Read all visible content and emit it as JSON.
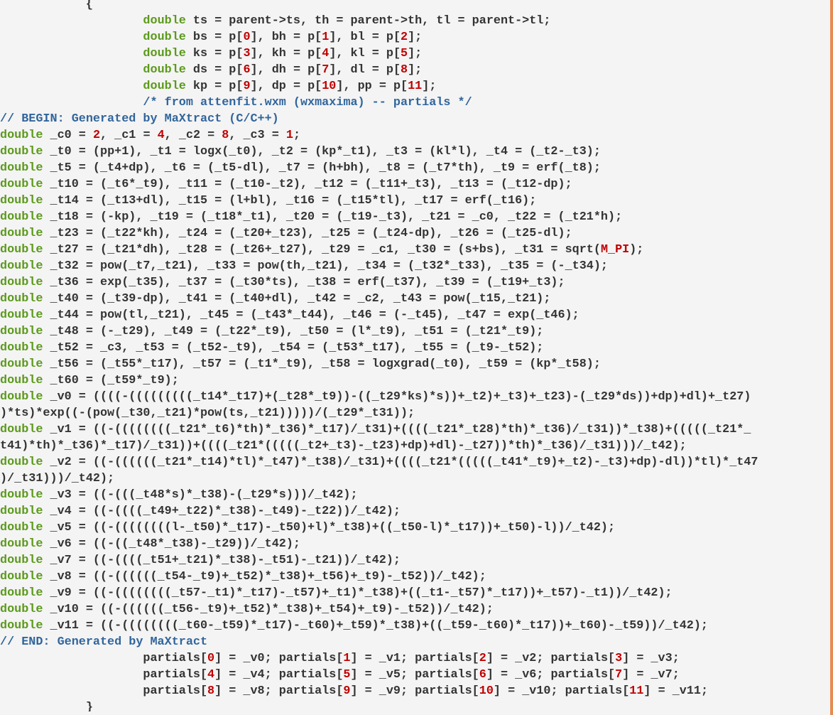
{
  "colors": {
    "background": "#f4f4f4",
    "keyword": "#5c9a1c",
    "number": "#c00000",
    "comment": "#31659c",
    "text": "#333333",
    "edge_bar": "#e58b52"
  },
  "lines": [
    [
      [
        "p",
        "            {"
      ]
    ],
    [
      [
        "p",
        "                    "
      ],
      [
        "k",
        "double"
      ],
      [
        "p",
        " ts = parent->ts, th = parent->th, tl = parent->tl;"
      ]
    ],
    [
      [
        "p",
        "                    "
      ],
      [
        "k",
        "double"
      ],
      [
        "p",
        " bs = p["
      ],
      [
        "n",
        "0"
      ],
      [
        "p",
        "], bh = p["
      ],
      [
        "n",
        "1"
      ],
      [
        "p",
        "], bl = p["
      ],
      [
        "n",
        "2"
      ],
      [
        "p",
        "];"
      ]
    ],
    [
      [
        "p",
        "                    "
      ],
      [
        "k",
        "double"
      ],
      [
        "p",
        " ks = p["
      ],
      [
        "n",
        "3"
      ],
      [
        "p",
        "], kh = p["
      ],
      [
        "n",
        "4"
      ],
      [
        "p",
        "], kl = p["
      ],
      [
        "n",
        "5"
      ],
      [
        "p",
        "];"
      ]
    ],
    [
      [
        "p",
        "                    "
      ],
      [
        "k",
        "double"
      ],
      [
        "p",
        " ds = p["
      ],
      [
        "n",
        "6"
      ],
      [
        "p",
        "], dh = p["
      ],
      [
        "n",
        "7"
      ],
      [
        "p",
        "], dl = p["
      ],
      [
        "n",
        "8"
      ],
      [
        "p",
        "];"
      ]
    ],
    [
      [
        "p",
        "                    "
      ],
      [
        "k",
        "double"
      ],
      [
        "p",
        " kp = p["
      ],
      [
        "n",
        "9"
      ],
      [
        "p",
        "], dp = p["
      ],
      [
        "n",
        "10"
      ],
      [
        "p",
        "], pp = p["
      ],
      [
        "n",
        "11"
      ],
      [
        "p",
        "];"
      ]
    ],
    [
      [
        "p",
        "                    "
      ],
      [
        "c",
        "/* from attenfit.wxm (wxmaxima) -- partials */"
      ]
    ],
    [
      [
        "c",
        "// BEGIN: Generated by MaXtract (C/C++)"
      ]
    ],
    [
      [
        "k",
        "double"
      ],
      [
        "p",
        " _c0 = "
      ],
      [
        "n",
        "2"
      ],
      [
        "p",
        ", _c1 = "
      ],
      [
        "n",
        "4"
      ],
      [
        "p",
        ", _c2 = "
      ],
      [
        "n",
        "8"
      ],
      [
        "p",
        ", _c3 = "
      ],
      [
        "n",
        "1"
      ],
      [
        "p",
        ";"
      ]
    ],
    [
      [
        "k",
        "double"
      ],
      [
        "p",
        " _t0 = (pp+1), _t1 = logx(_t0), _t2 = (kp*_t1), _t3 = (kl*l), _t4 = (_t2-_t3);"
      ]
    ],
    [
      [
        "k",
        "double"
      ],
      [
        "p",
        " _t5 = (_t4+dp), _t6 = (_t5-dl), _t7 = (h+bh), _t8 = (_t7*th), _t9 = erf(_t8);"
      ]
    ],
    [
      [
        "k",
        "double"
      ],
      [
        "p",
        " _t10 = (_t6*_t9), _t11 = (_t10-_t2), _t12 = (_t11+_t3), _t13 = (_t12-dp);"
      ]
    ],
    [
      [
        "k",
        "double"
      ],
      [
        "p",
        " _t14 = (_t13+dl), _t15 = (l+bl), _t16 = (_t15*tl), _t17 = erf(_t16);"
      ]
    ],
    [
      [
        "k",
        "double"
      ],
      [
        "p",
        " _t18 = (-kp), _t19 = (_t18*_t1), _t20 = (_t19-_t3), _t21 = _c0, _t22 = (_t21*h);"
      ]
    ],
    [
      [
        "k",
        "double"
      ],
      [
        "p",
        " _t23 = (_t22*kh), _t24 = (_t20+_t23), _t25 = (_t24-dp), _t26 = (_t25-dl);"
      ]
    ],
    [
      [
        "k",
        "double"
      ],
      [
        "p",
        " _t27 = (_t21*dh), _t28 = (_t26+_t27), _t29 = _c1, _t30 = (s+bs), _t31 = sqrt("
      ],
      [
        "x",
        "M_PI"
      ],
      [
        "p",
        ");"
      ]
    ],
    [
      [
        "k",
        "double"
      ],
      [
        "p",
        " _t32 = pow(_t7,_t21), _t33 = pow(th,_t21), _t34 = (_t32*_t33), _t35 = (-_t34);"
      ]
    ],
    [
      [
        "k",
        "double"
      ],
      [
        "p",
        " _t36 = exp(_t35), _t37 = (_t30*ts), _t38 = erf(_t37), _t39 = (_t19+_t3);"
      ]
    ],
    [
      [
        "k",
        "double"
      ],
      [
        "p",
        " _t40 = (_t39-dp), _t41 = (_t40+dl), _t42 = _c2, _t43 = pow(_t15,_t21);"
      ]
    ],
    [
      [
        "k",
        "double"
      ],
      [
        "p",
        " _t44 = pow(tl,_t21), _t45 = (_t43*_t44), _t46 = (-_t45), _t47 = exp(_t46);"
      ]
    ],
    [
      [
        "k",
        "double"
      ],
      [
        "p",
        " _t48 = (-_t29), _t49 = (_t22*_t9), _t50 = (l*_t9), _t51 = (_t21*_t9);"
      ]
    ],
    [
      [
        "k",
        "double"
      ],
      [
        "p",
        " _t52 = _c3, _t53 = (_t52-_t9), _t54 = (_t53*_t17), _t55 = (_t9-_t52);"
      ]
    ],
    [
      [
        "k",
        "double"
      ],
      [
        "p",
        " _t56 = (_t55*_t17), _t57 = (_t1*_t9), _t58 = logxgrad(_t0), _t59 = (kp*_t58);"
      ]
    ],
    [
      [
        "k",
        "double"
      ],
      [
        "p",
        " _t60 = (_t59*_t9);"
      ]
    ],
    [
      [
        "k",
        "double"
      ],
      [
        "p",
        " _v0 = ((((-(((((((((_t14*_t17)+(_t28*_t9))-((_t29*ks)*s))+_t2)+_t3)+_t23)-(_t29*ds))+dp)+dl)+_t27)"
      ]
    ],
    [
      [
        "p",
        ")*ts)*exp((-(pow(_t30,_t21)*pow(ts,_t21)))))/(_t29*_t31));"
      ]
    ],
    [
      [
        "k",
        "double"
      ],
      [
        "p",
        " _v1 = ((-((((((((_t21*_t6)*th)*_t36)*_t17)/_t31)+((((_t21*_t28)*th)*_t36)/_t31))*_t38)+(((((_t21*_"
      ]
    ],
    [
      [
        "p",
        "t41)*th)*_t36)*_t17)/_t31))+((((_t21*(((((_t2+_t3)-_t23)+dp)+dl)-_t27))*th)*_t36)/_t31)))/_t42);"
      ]
    ],
    [
      [
        "k",
        "double"
      ],
      [
        "p",
        " _v2 = ((-((((((_t21*_t14)*tl)*_t47)*_t38)/_t31)+((((_t21*(((((_t41*_t9)+_t2)-_t3)+dp)-dl))*tl)*_t47"
      ]
    ],
    [
      [
        "p",
        ")/_t31)))/_t42);"
      ]
    ],
    [
      [
        "k",
        "double"
      ],
      [
        "p",
        " _v3 = ((-(((_t48*s)*_t38)-(_t29*s)))/_t42);"
      ]
    ],
    [
      [
        "k",
        "double"
      ],
      [
        "p",
        " _v4 = ((-((((_t49+_t22)*_t38)-_t49)-_t22))/_t42);"
      ]
    ],
    [
      [
        "k",
        "double"
      ],
      [
        "p",
        " _v5 = ((-((((((((l-_t50)*_t17)-_t50)+l)*_t38)+((_t50-l)*_t17))+_t50)-l))/_t42);"
      ]
    ],
    [
      [
        "k",
        "double"
      ],
      [
        "p",
        " _v6 = ((-((_t48*_t38)-_t29))/_t42);"
      ]
    ],
    [
      [
        "k",
        "double"
      ],
      [
        "p",
        " _v7 = ((-((((_t51+_t21)*_t38)-_t51)-_t21))/_t42);"
      ]
    ],
    [
      [
        "k",
        "double"
      ],
      [
        "p",
        " _v8 = ((-((((((_t54-_t9)+_t52)*_t38)+_t56)+_t9)-_t52))/_t42);"
      ]
    ],
    [
      [
        "k",
        "double"
      ],
      [
        "p",
        " _v9 = ((-((((((((_t57-_t1)*_t17)-_t57)+_t1)*_t38)+((_t1-_t57)*_t17))+_t57)-_t1))/_t42);"
      ]
    ],
    [
      [
        "k",
        "double"
      ],
      [
        "p",
        " _v10 = ((-((((((_t56-_t9)+_t52)*_t38)+_t54)+_t9)-_t52))/_t42);"
      ]
    ],
    [
      [
        "k",
        "double"
      ],
      [
        "p",
        " _v11 = ((-((((((((_t60-_t59)*_t17)-_t60)+_t59)*_t38)+((_t59-_t60)*_t17))+_t60)-_t59))/_t42);"
      ]
    ],
    [
      [
        "c",
        "// END: Generated by MaXtract"
      ]
    ],
    [
      [
        "p",
        "                    partials["
      ],
      [
        "n",
        "0"
      ],
      [
        "p",
        "] = _v0; partials["
      ],
      [
        "n",
        "1"
      ],
      [
        "p",
        "] = _v1; partials["
      ],
      [
        "n",
        "2"
      ],
      [
        "p",
        "] = _v2; partials["
      ],
      [
        "n",
        "3"
      ],
      [
        "p",
        "] = _v3;"
      ]
    ],
    [
      [
        "p",
        "                    partials["
      ],
      [
        "n",
        "4"
      ],
      [
        "p",
        "] = _v4; partials["
      ],
      [
        "n",
        "5"
      ],
      [
        "p",
        "] = _v5; partials["
      ],
      [
        "n",
        "6"
      ],
      [
        "p",
        "] = _v6; partials["
      ],
      [
        "n",
        "7"
      ],
      [
        "p",
        "] = _v7;"
      ]
    ],
    [
      [
        "p",
        "                    partials["
      ],
      [
        "n",
        "8"
      ],
      [
        "p",
        "] = _v8; partials["
      ],
      [
        "n",
        "9"
      ],
      [
        "p",
        "] = _v9; partials["
      ],
      [
        "n",
        "10"
      ],
      [
        "p",
        "] = _v10; partials["
      ],
      [
        "n",
        "11"
      ],
      [
        "p",
        "] = _v11;"
      ]
    ],
    [
      [
        "p",
        "            }"
      ]
    ]
  ]
}
